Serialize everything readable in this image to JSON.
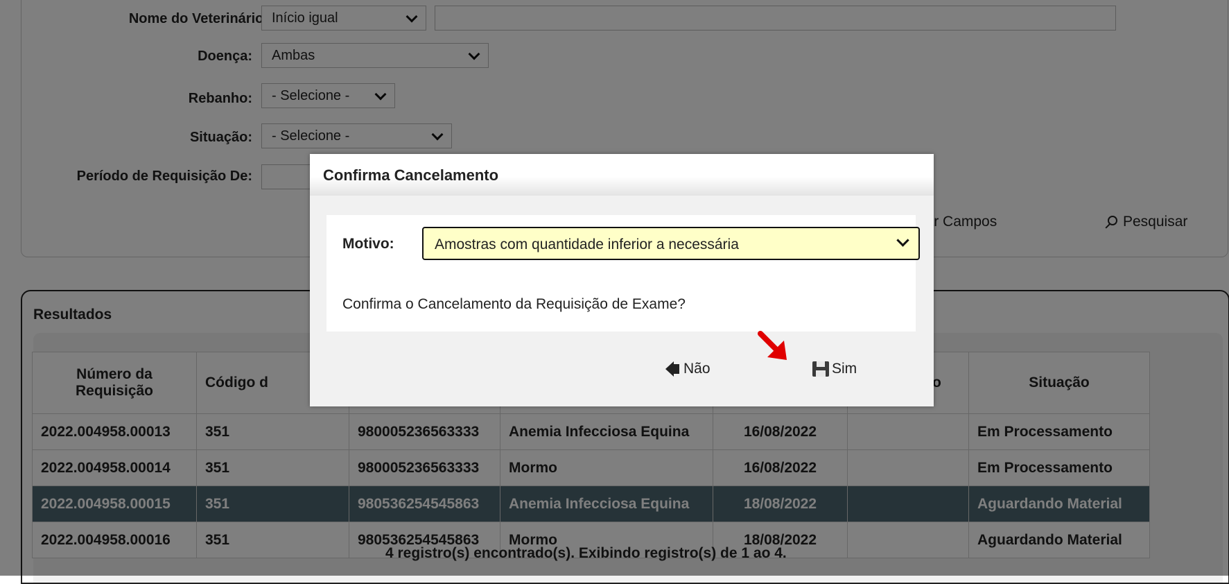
{
  "filters": {
    "vet_label": "Nome do Veterinário:",
    "vet_match": "Início igual",
    "vet_value": "",
    "doenca_label": "Doença:",
    "doenca_value": "Ambas",
    "rebanho_label": "Rebanho:",
    "rebanho_value": "- Selecione -",
    "situacao_label": "Situação:",
    "situacao_value": "- Selecione -",
    "periodo_label": "Período de Requisição De:",
    "periodo_value": "",
    "clear_label": "Limpar Campos",
    "search_label": "Pesquisar"
  },
  "results": {
    "title": "Resultados",
    "columns": [
      "Número da Requisição",
      "Código d",
      "",
      "",
      "",
      "eterinário",
      "Situação"
    ],
    "rows": [
      [
        "2022.004958.00013",
        "351",
        "980005236563333",
        "Anemia Infecciosa Equina",
        "16/08/2022",
        "",
        "Em Processamento"
      ],
      [
        "2022.004958.00014",
        "351",
        "980005236563333",
        "Mormo",
        "16/08/2022",
        "",
        "Em Processamento"
      ],
      [
        "2022.004958.00015",
        "351",
        "980536254545863",
        "Anemia Infecciosa Equina",
        "18/08/2022",
        "",
        "Aguardando Material"
      ],
      [
        "2022.004958.00016",
        "351",
        "980536254545863",
        "Mormo",
        "18/08/2022",
        "",
        "Aguardando Material"
      ]
    ],
    "footer": "4 registro(s) encontrado(s). Exibindo registro(s) de 1 ao 4."
  },
  "dialog": {
    "title": "Confirma Cancelamento",
    "motivo_label": "Motivo:",
    "motivo_value": "Amostras com quantidade inferior a necessária",
    "confirm_text": "Confirma o Cancelamento da Requisição de Exame?",
    "no_label": "Não",
    "yes_label": "Sim"
  },
  "colors": {
    "overlay": "#808080",
    "selected_row": "#4d6770",
    "motivo_bg": "#ffffc8",
    "arrow": "#e00000"
  },
  "icons": [
    "clear-icon",
    "search-icon",
    "back-icon",
    "save-icon",
    "red-arrow-icon",
    "chevron-down-icon"
  ]
}
